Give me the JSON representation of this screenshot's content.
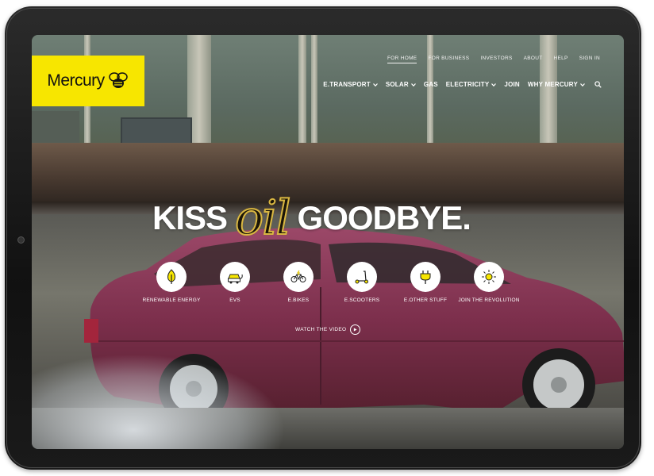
{
  "brand": {
    "name": "Mercury",
    "accent": "#f7e600"
  },
  "top_nav": [
    {
      "label": "FOR HOME",
      "active": true
    },
    {
      "label": "FOR BUSINESS",
      "active": false
    },
    {
      "label": "INVESTORS",
      "active": false
    },
    {
      "label": "ABOUT",
      "active": false
    },
    {
      "label": "HELP",
      "active": false
    },
    {
      "label": "SIGN IN",
      "active": false
    }
  ],
  "main_nav": [
    {
      "label": "E.TRANSPORT",
      "dropdown": true
    },
    {
      "label": "SOLAR",
      "dropdown": true
    },
    {
      "label": "GAS",
      "dropdown": false
    },
    {
      "label": "ELECTRICITY",
      "dropdown": true
    },
    {
      "label": "JOIN",
      "dropdown": false
    },
    {
      "label": "WHY MERCURY",
      "dropdown": true
    }
  ],
  "search_icon": "search-icon",
  "hero": {
    "headline_left": "KISS",
    "headline_script": "oil",
    "headline_right": "GOODBYE."
  },
  "categories": [
    {
      "label": "RENEWABLE ENERGY",
      "icon": "tree-icon"
    },
    {
      "label": "EVS",
      "icon": "car-plug-icon"
    },
    {
      "label": "E.BIKES",
      "icon": "bike-icon"
    },
    {
      "label": "E.SCOOTERS",
      "icon": "scooter-icon"
    },
    {
      "label": "E.OTHER STUFF",
      "icon": "plug-icon"
    },
    {
      "label": "JOIN THE REVOLUTION",
      "icon": "sun-icon"
    }
  ],
  "watch_video": {
    "label": "WATCH THE VIDEO",
    "icon": "play-icon"
  }
}
